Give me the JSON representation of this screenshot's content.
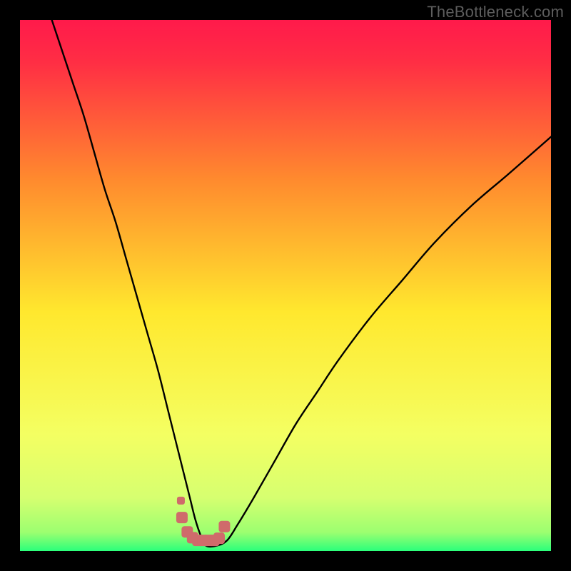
{
  "watermark": "TheBottleneck.com",
  "colors": {
    "frame_bg": "#000000",
    "curve_stroke": "#000000",
    "marker_stroke": "#cf6b6b",
    "marker_fill": "#cf6b6b",
    "gradient_top": "#ff1a4b",
    "gradient_mid1": "#ff9b2e",
    "gradient_mid2": "#ffe82e",
    "gradient_mid3": "#f4ff62",
    "gradient_bottom": "#2bff7b"
  },
  "chart_data": {
    "type": "line",
    "title": "",
    "xlabel": "",
    "ylabel": "",
    "xlim": [
      0,
      100
    ],
    "ylim": [
      0,
      100
    ],
    "series": [
      {
        "name": "bottleneck-curve",
        "x": [
          6,
          8,
          10,
          12,
          14,
          16,
          18,
          20,
          22,
          24,
          26,
          28,
          30,
          31,
          32,
          33,
          34,
          35,
          37,
          39,
          41,
          44,
          48,
          52,
          56,
          60,
          66,
          72,
          78,
          85,
          92,
          100
        ],
        "y": [
          100,
          94,
          88,
          82,
          75,
          68,
          62,
          55,
          48,
          41,
          34,
          26,
          18,
          14,
          10,
          6,
          3,
          1,
          1,
          2,
          5,
          10,
          17,
          24,
          30,
          36,
          44,
          51,
          58,
          65,
          71,
          78
        ]
      }
    ],
    "markers": {
      "name": "optimal-range",
      "x": [
        30.5,
        31.5,
        32.5,
        33.5,
        34.5,
        35.5,
        36.5,
        37.5,
        38.5
      ],
      "y": [
        6.3,
        3.6,
        2.5,
        2.0,
        2.0,
        2.0,
        2.0,
        2.4,
        4.6
      ]
    },
    "marker_dot": {
      "x": 30.3,
      "y": 9.5
    },
    "gradient_stops": [
      {
        "offset": 0.0,
        "color": "#ff1a4b"
      },
      {
        "offset": 0.08,
        "color": "#ff2e44"
      },
      {
        "offset": 0.3,
        "color": "#ff8a2e"
      },
      {
        "offset": 0.55,
        "color": "#ffe82e"
      },
      {
        "offset": 0.78,
        "color": "#f4ff62"
      },
      {
        "offset": 0.9,
        "color": "#d6ff70"
      },
      {
        "offset": 0.965,
        "color": "#9cff70"
      },
      {
        "offset": 1.0,
        "color": "#2bff7b"
      }
    ]
  }
}
